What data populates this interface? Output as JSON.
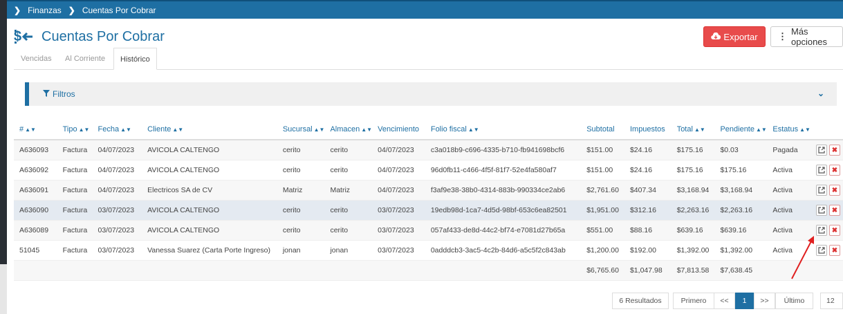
{
  "breadcrumb": {
    "items": [
      "Finanzas",
      "Cuentas Por Cobrar"
    ]
  },
  "page": {
    "title": "Cuentas Por Cobrar"
  },
  "actions": {
    "export_label": "Exportar",
    "more_label": "Más opciones"
  },
  "tabs": [
    {
      "label": "Vencidas",
      "active": false
    },
    {
      "label": "Al Corriente",
      "active": false
    },
    {
      "label": "Histórico",
      "active": true
    }
  ],
  "filters": {
    "label": "Filtros"
  },
  "table": {
    "headers": [
      "#",
      "Tipo",
      "Fecha",
      "Cliente",
      "Sucursal",
      "Almacen",
      "Vencimiento",
      "Folio fiscal",
      "Subtotal",
      "Impuestos",
      "Total",
      "Pendiente",
      "Estatus"
    ],
    "rows": [
      {
        "num": "A636093",
        "tipo": "Factura",
        "fecha": "04/07/2023",
        "cliente": "AVICOLA CALTENGO",
        "sucursal": "cerito",
        "almacen": "cerito",
        "vencimiento": "04/07/2023",
        "folio": "c3a018b9-c696-4335-b710-fb941698bcf6",
        "subtotal": "$151.00",
        "impuestos": "$24.16",
        "total": "$175.16",
        "pendiente": "$0.03",
        "estatus": "Pagada"
      },
      {
        "num": "A636092",
        "tipo": "Factura",
        "fecha": "04/07/2023",
        "cliente": "AVICOLA CALTENGO",
        "sucursal": "cerito",
        "almacen": "cerito",
        "vencimiento": "04/07/2023",
        "folio": "96d0fb11-c466-4f5f-81f7-52e4fa580af7",
        "subtotal": "$151.00",
        "impuestos": "$24.16",
        "total": "$175.16",
        "pendiente": "$175.16",
        "estatus": "Activa"
      },
      {
        "num": "A636091",
        "tipo": "Factura",
        "fecha": "04/07/2023",
        "cliente": "Electricos SA de CV",
        "sucursal": "Matriz",
        "almacen": "Matriz",
        "vencimiento": "04/07/2023",
        "folio": "f3af9e38-38b0-4314-883b-990334ce2ab6",
        "subtotal": "$2,761.60",
        "impuestos": "$407.34",
        "total": "$3,168.94",
        "pendiente": "$3,168.94",
        "estatus": "Activa"
      },
      {
        "num": "A636090",
        "tipo": "Factura",
        "fecha": "03/07/2023",
        "cliente": "AVICOLA CALTENGO",
        "sucursal": "cerito",
        "almacen": "cerito",
        "vencimiento": "03/07/2023",
        "folio": "19edb98d-1ca7-4d5d-98bf-653c6ea82501",
        "subtotal": "$1,951.00",
        "impuestos": "$312.16",
        "total": "$2,263.16",
        "pendiente": "$2,263.16",
        "estatus": "Activa"
      },
      {
        "num": "A636089",
        "tipo": "Factura",
        "fecha": "03/07/2023",
        "cliente": "AVICOLA CALTENGO",
        "sucursal": "cerito",
        "almacen": "cerito",
        "vencimiento": "03/07/2023",
        "folio": "057af433-de8d-44c2-bf74-e7081d27b65a",
        "subtotal": "$551.00",
        "impuestos": "$88.16",
        "total": "$639.16",
        "pendiente": "$639.16",
        "estatus": "Activa"
      },
      {
        "num": "51045",
        "tipo": "Factura",
        "fecha": "03/07/2023",
        "cliente": "Vanessa Suarez (Carta Porte Ingreso)",
        "sucursal": "jonan",
        "almacen": "jonan",
        "vencimiento": "03/07/2023",
        "folio": "0adddcb3-3ac5-4c2b-84d6-a5c5f2c843ab",
        "subtotal": "$1,200.00",
        "impuestos": "$192.00",
        "total": "$1,392.00",
        "pendiente": "$1,392.00",
        "estatus": "Activa"
      }
    ],
    "totals": {
      "subtotal": "$6,765.60",
      "impuestos": "$1,047.98",
      "total": "$7,813.58",
      "pendiente": "$7,638.45"
    }
  },
  "pagination": {
    "results_label": "6 Resultados",
    "first_label": "Primero",
    "prev_label": "<<",
    "current_page": "1",
    "next_label": ">>",
    "last_label": "Último",
    "page_size": "12"
  },
  "colors": {
    "primary": "#1e6fa3",
    "danger": "#e84b4b",
    "annotation_arrow": "#e02020"
  }
}
